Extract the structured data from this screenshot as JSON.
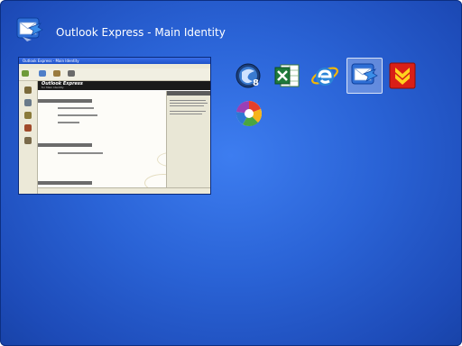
{
  "switcher": {
    "title": "Outlook Express - Main Identity",
    "selected_index": 3,
    "preview": {
      "window_title": "Outlook Express - Main Identity",
      "brand": "Outlook Express",
      "brand_subtitle": "for Main Identity"
    },
    "windows": [
      {
        "app_icon": "safari-s8-icon"
      },
      {
        "app_icon": "excel-icon"
      },
      {
        "app_icon": "internet-explorer-icon"
      },
      {
        "app_icon": "outlook-express-icon"
      },
      {
        "app_icon": "download-manager-icon"
      },
      {
        "app_icon": "picasa-icon"
      }
    ]
  },
  "colors": {
    "background": "#2a63d6",
    "title_text": "#ffffff",
    "selection_highlight": "#ffffff"
  }
}
